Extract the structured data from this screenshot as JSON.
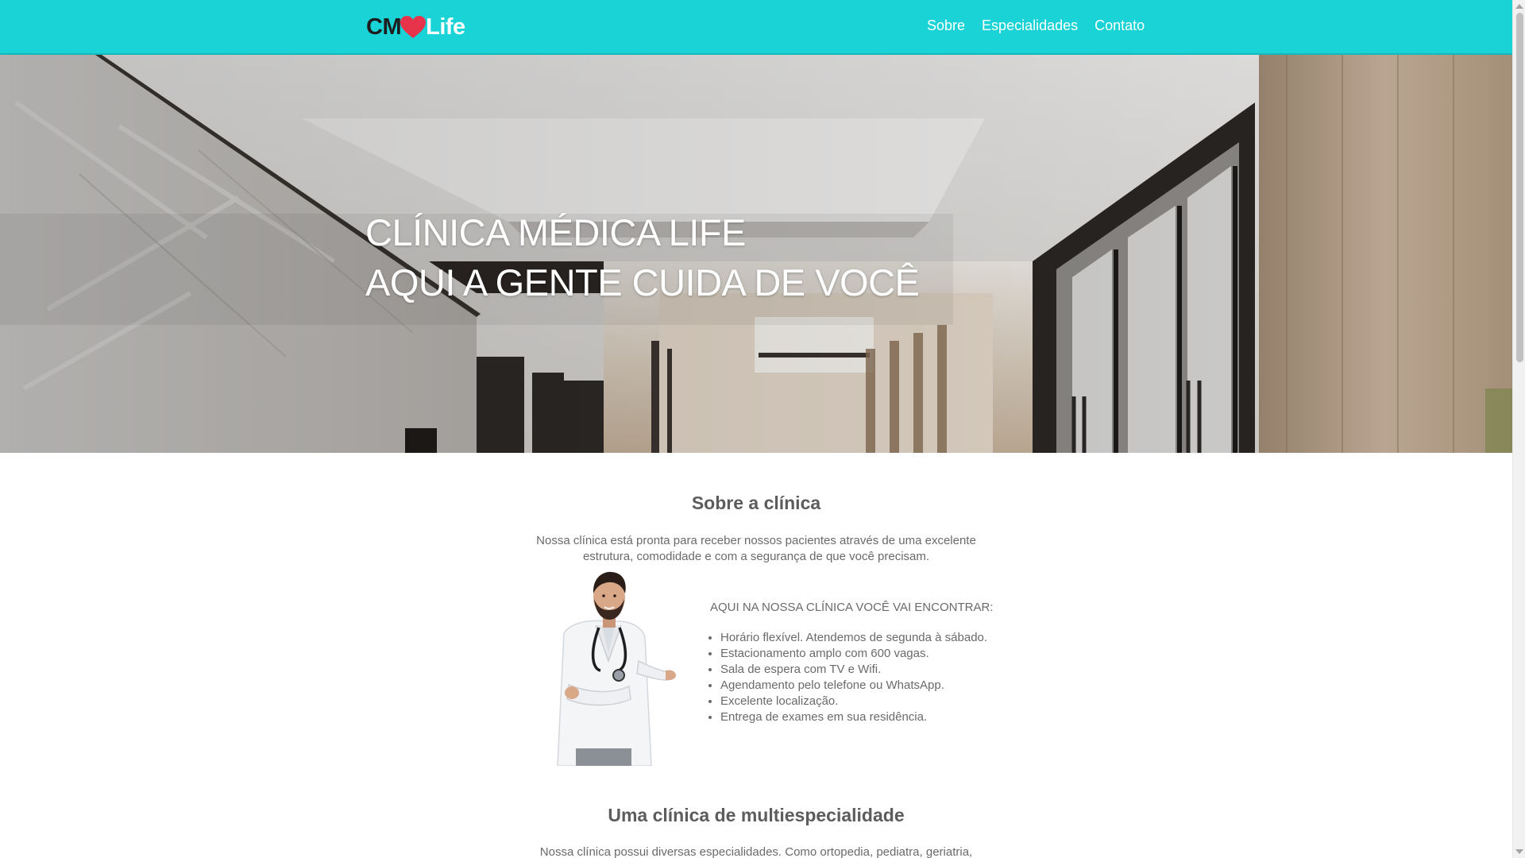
{
  "brand": {
    "logo_left": "CM",
    "logo_right": "Life",
    "heart_color": "#e8344a",
    "accent_color": "#19d3d6"
  },
  "nav": {
    "items": [
      {
        "label": "Sobre"
      },
      {
        "label": "Especialidades"
      },
      {
        "label": "Contato"
      }
    ]
  },
  "hero": {
    "title_line1": "CLÍNICA MÉDICA LIFE",
    "title_line2": "AQUI A GENTE CUIDA DE VOCÊ"
  },
  "about": {
    "title": "Sobre a clínica",
    "text": "Nossa clínica está pronta para receber nossos pacientes através de uma excelente estrutura, comodidade e com a segurança de que você precisam.",
    "features_heading": "AQUI NA NOSSA CLÍNICA VOCÊ VAI ENCONTRAR:",
    "features": [
      "Horário flexível. Atendemos de segunda à sábado.",
      "Estacionamento amplo com 600 vagas.",
      "Sala de espera com TV e Wifi.",
      "Agendamento pelo telefone ou WhatsApp.",
      "Excelente localização.",
      "Entrega de exames em sua residência."
    ]
  },
  "specialties": {
    "title": "Uma clínica de multiespecialidade",
    "text": "Nossa clínica possui diversas especialidades. Como ortopedia, pediatra, geriatria,"
  }
}
